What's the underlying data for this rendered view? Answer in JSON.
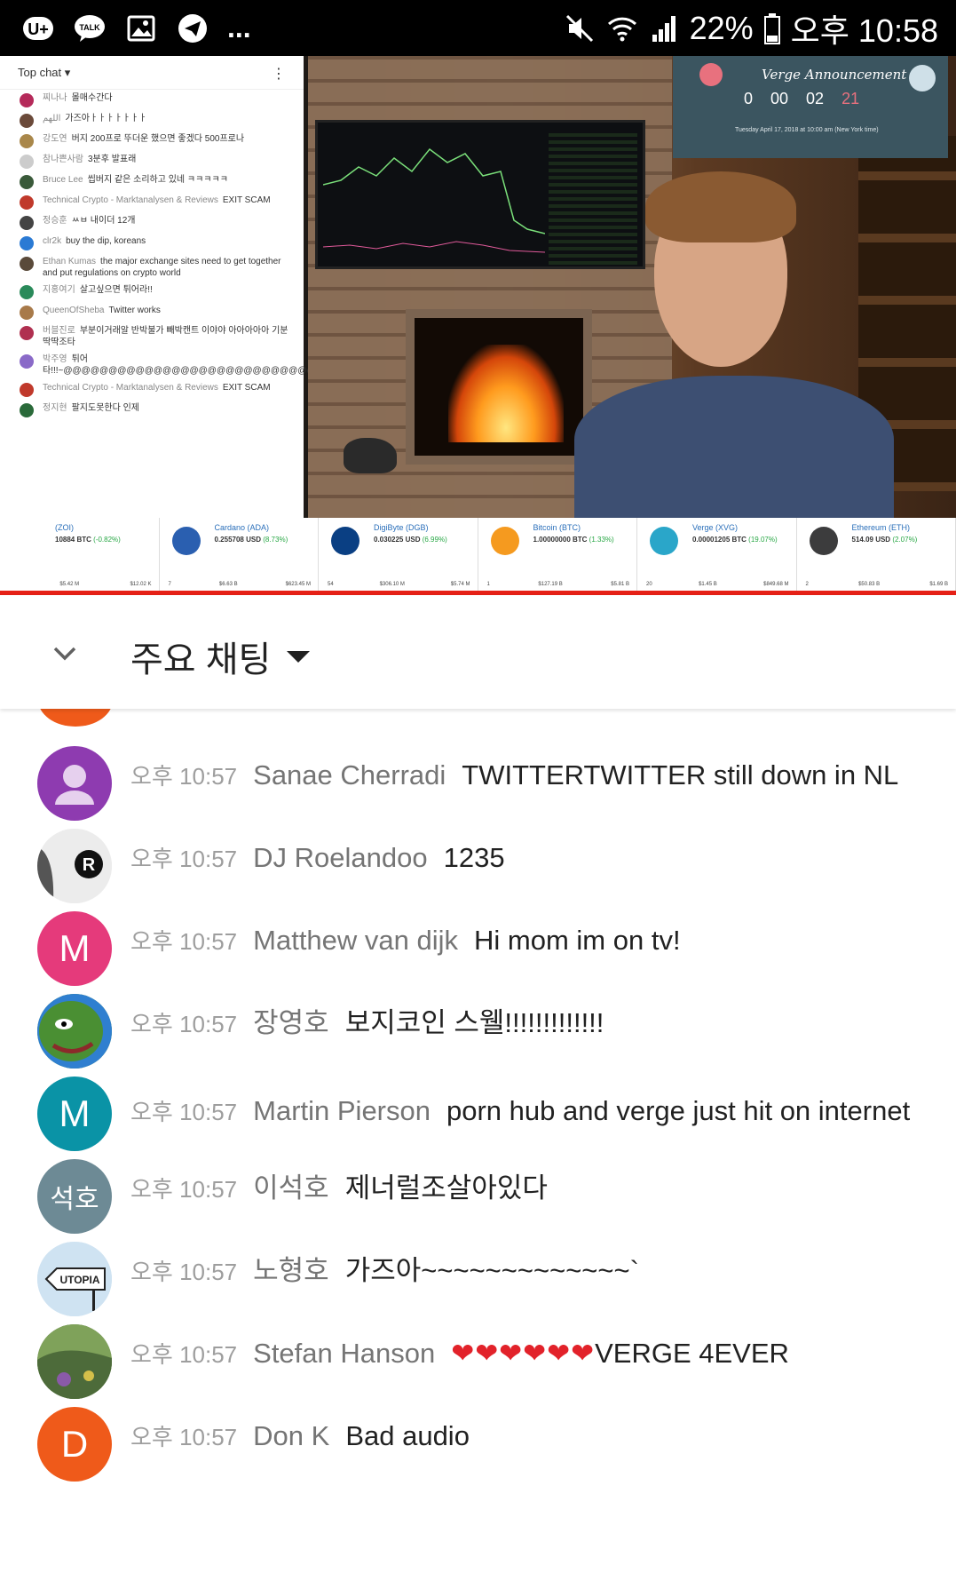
{
  "status_bar": {
    "icons": [
      "u-plus-icon",
      "talk-icon",
      "gallery-icon",
      "telegram-icon"
    ],
    "overflow": "...",
    "battery": "22%",
    "time": "오후 10:58"
  },
  "video": {
    "embedded_chat": {
      "header": "Top chat",
      "rows": [
        {
          "author": "찌나나",
          "text": "몰매수간다"
        },
        {
          "author": "اللهم",
          "text": "가즈아ㅏㅏㅏㅏㅏㅏㅏ"
        },
        {
          "author": "강도연",
          "text": "버지 200프로 뚜더운 했으면 좋겠다 500프로나"
        },
        {
          "author": "참나쁜사람",
          "text": "3분후 발표래"
        },
        {
          "author": "Bruce Lee",
          "text": "씹버지 같은 소리하고 있네 ㅋㅋㅋㅋㅋ"
        },
        {
          "author": "Technical Crypto - Marktanalysen & Reviews",
          "text": "EXIT SCAM"
        },
        {
          "author": "정승훈",
          "text": "ㅆㅂ 내이더 12개"
        },
        {
          "author": "clr2k",
          "text": "buy the dip, koreans"
        },
        {
          "author": "Ethan Kumas",
          "text": "the major exchange sites need to get together and put regulations on crypto world"
        },
        {
          "author": "지홍여기",
          "text": "살고싶으면 튀어라!!"
        },
        {
          "author": "QueenOfSheba",
          "text": "Twitter works"
        },
        {
          "author": "버블진로",
          "text": "부분이거래알 반박불가 빼박캔트 이야야 아아아아아 기분 딱딱조타"
        },
        {
          "author": "박주영",
          "text": "튀어 타!!!~@@@@@@@@@@@@@@@@@@@@@@@@@@@@@@"
        },
        {
          "author": "Technical Crypto - Marktanalysen & Reviews",
          "text": "EXIT SCAM"
        },
        {
          "author": "정지현",
          "text": "팔지도못한다 인제"
        }
      ]
    },
    "announcement": {
      "title": "Verge Announcement",
      "countdown": [
        "0",
        "00",
        "02",
        "21"
      ],
      "subtitle": "Tuesday April 17, 2018 at 10:00 am (New York time)"
    },
    "ticker": [
      {
        "name": "(ZOI)",
        "price": "10884 BTC",
        "change": "(-0.82%)",
        "rank": "",
        "cap": "$5.42 M",
        "vol": "$12.02 K",
        "logo_color": "#ffffff"
      },
      {
        "name": "Cardano (ADA)",
        "price": "0.255708 USD",
        "change": "(8.73%)",
        "rank": "7",
        "cap": "$6.63 B",
        "vol": "$623.45 M",
        "logo_color": "#2a5fb0"
      },
      {
        "name": "DigiByte (DGB)",
        "price": "0.030225 USD",
        "change": "(6.99%)",
        "rank": "54",
        "cap": "$306.10 M",
        "vol": "$5.74 M",
        "logo_color": "#0a3f83"
      },
      {
        "name": "Bitcoin (BTC)",
        "price": "1.00000000 BTC",
        "change": "(1.33%)",
        "rank": "1",
        "cap": "$127.19 B",
        "vol": "$5.81 B",
        "logo_color": "#f59a1f"
      },
      {
        "name": "Verge (XVG)",
        "price": "0.00001205 BTC",
        "change": "(19.07%)",
        "rank": "20",
        "cap": "$1.45 B",
        "vol": "$849.68 M",
        "logo_color": "#2aa6c9"
      },
      {
        "name": "Ethereum (ETH)",
        "price": "514.09 USD",
        "change": "(2.07%)",
        "rank": "2",
        "cap": "$50.83 B",
        "vol": "$1.69 B",
        "logo_color": "#3c3c3d"
      }
    ]
  },
  "chat": {
    "title": "주요 채팅",
    "messages": [
      {
        "time": "오후 10:57",
        "author": "Sanae Cherradi",
        "text": "TWITTERTWITTER still down in NL",
        "avatar_letter": "",
        "avatar_color": "#8e3bb0",
        "avatar_kind": "default-person-icon"
      },
      {
        "time": "오후 10:57",
        "author": "DJ Roelandoo",
        "text": "1235",
        "avatar_letter": "",
        "avatar_color": "#ececec",
        "avatar_kind": "roelandoo-logo"
      },
      {
        "time": "오후 10:57",
        "author": "Matthew van dijk",
        "text": "Hi mom im on tv!",
        "avatar_letter": "M",
        "avatar_color": "#e53a7b",
        "avatar_kind": "letter"
      },
      {
        "time": "오후 10:57",
        "author": "장영호",
        "text": "보지코인 스웰!!!!!!!!!!!!!",
        "avatar_letter": "",
        "avatar_color": "#3c8b2e",
        "avatar_kind": "pepe-image"
      },
      {
        "time": "오후 10:57",
        "author": "Martin Pierson",
        "text": "porn hub and verge just hit on internet",
        "avatar_letter": "M",
        "avatar_color": "#0a93a6",
        "avatar_kind": "letter"
      },
      {
        "time": "오후 10:57",
        "author": "이석호",
        "text": "제너럴조살아있다",
        "avatar_letter": "석호",
        "avatar_color": "#6d8a95",
        "avatar_kind": "letter"
      },
      {
        "time": "오후 10:57",
        "author": "노형호",
        "text": "가즈아~~~~~~~~~~~~~`",
        "avatar_letter": "",
        "avatar_color": "#cfe3f2",
        "avatar_kind": "utopia-sign"
      },
      {
        "time": "오후 10:57",
        "author": "Stefan Hanson",
        "hearts": "❤❤❤❤❤❤",
        "text": "VERGE 4EVER",
        "avatar_letter": "",
        "avatar_color": "#4d6b3a",
        "avatar_kind": "landscape-image"
      },
      {
        "time": "오후 10:57",
        "author": "Don K",
        "text": "Bad audio",
        "avatar_letter": "D",
        "avatar_color": "#ef5a1a",
        "avatar_kind": "letter"
      }
    ]
  }
}
